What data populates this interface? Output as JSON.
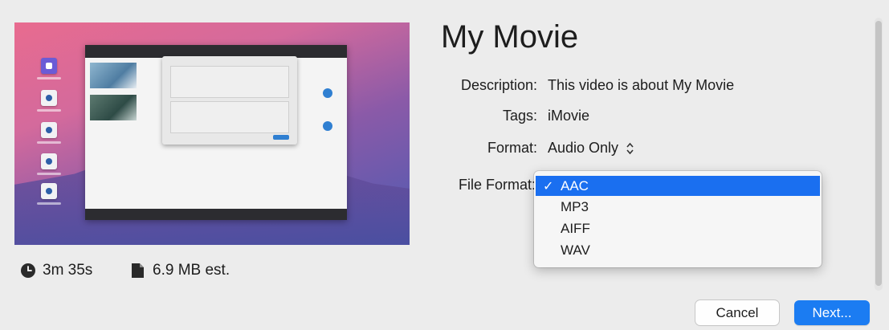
{
  "preview": {
    "thumbnail_icon": "imovie-project-thumbnail"
  },
  "stats": {
    "duration": "3m 35s",
    "duration_icon": "clock-icon",
    "size": "6.9 MB est.",
    "size_icon": "document-icon"
  },
  "details": {
    "title": "My Movie",
    "description_label": "Description:",
    "description_value": "This video is about My Movie",
    "tags_label": "Tags:",
    "tags_value": "iMovie",
    "format_label": "Format:",
    "format_value": "Audio Only",
    "file_format_label": "File Format:"
  },
  "file_format_menu": {
    "selected": "AAC",
    "options": [
      "AAC",
      "MP3",
      "AIFF",
      "WAV"
    ]
  },
  "buttons": {
    "cancel": "Cancel",
    "next": "Next..."
  },
  "colors": {
    "accent": "#1a6ff0",
    "next_button": "#1b7cf2",
    "window_background": "#ececec"
  }
}
